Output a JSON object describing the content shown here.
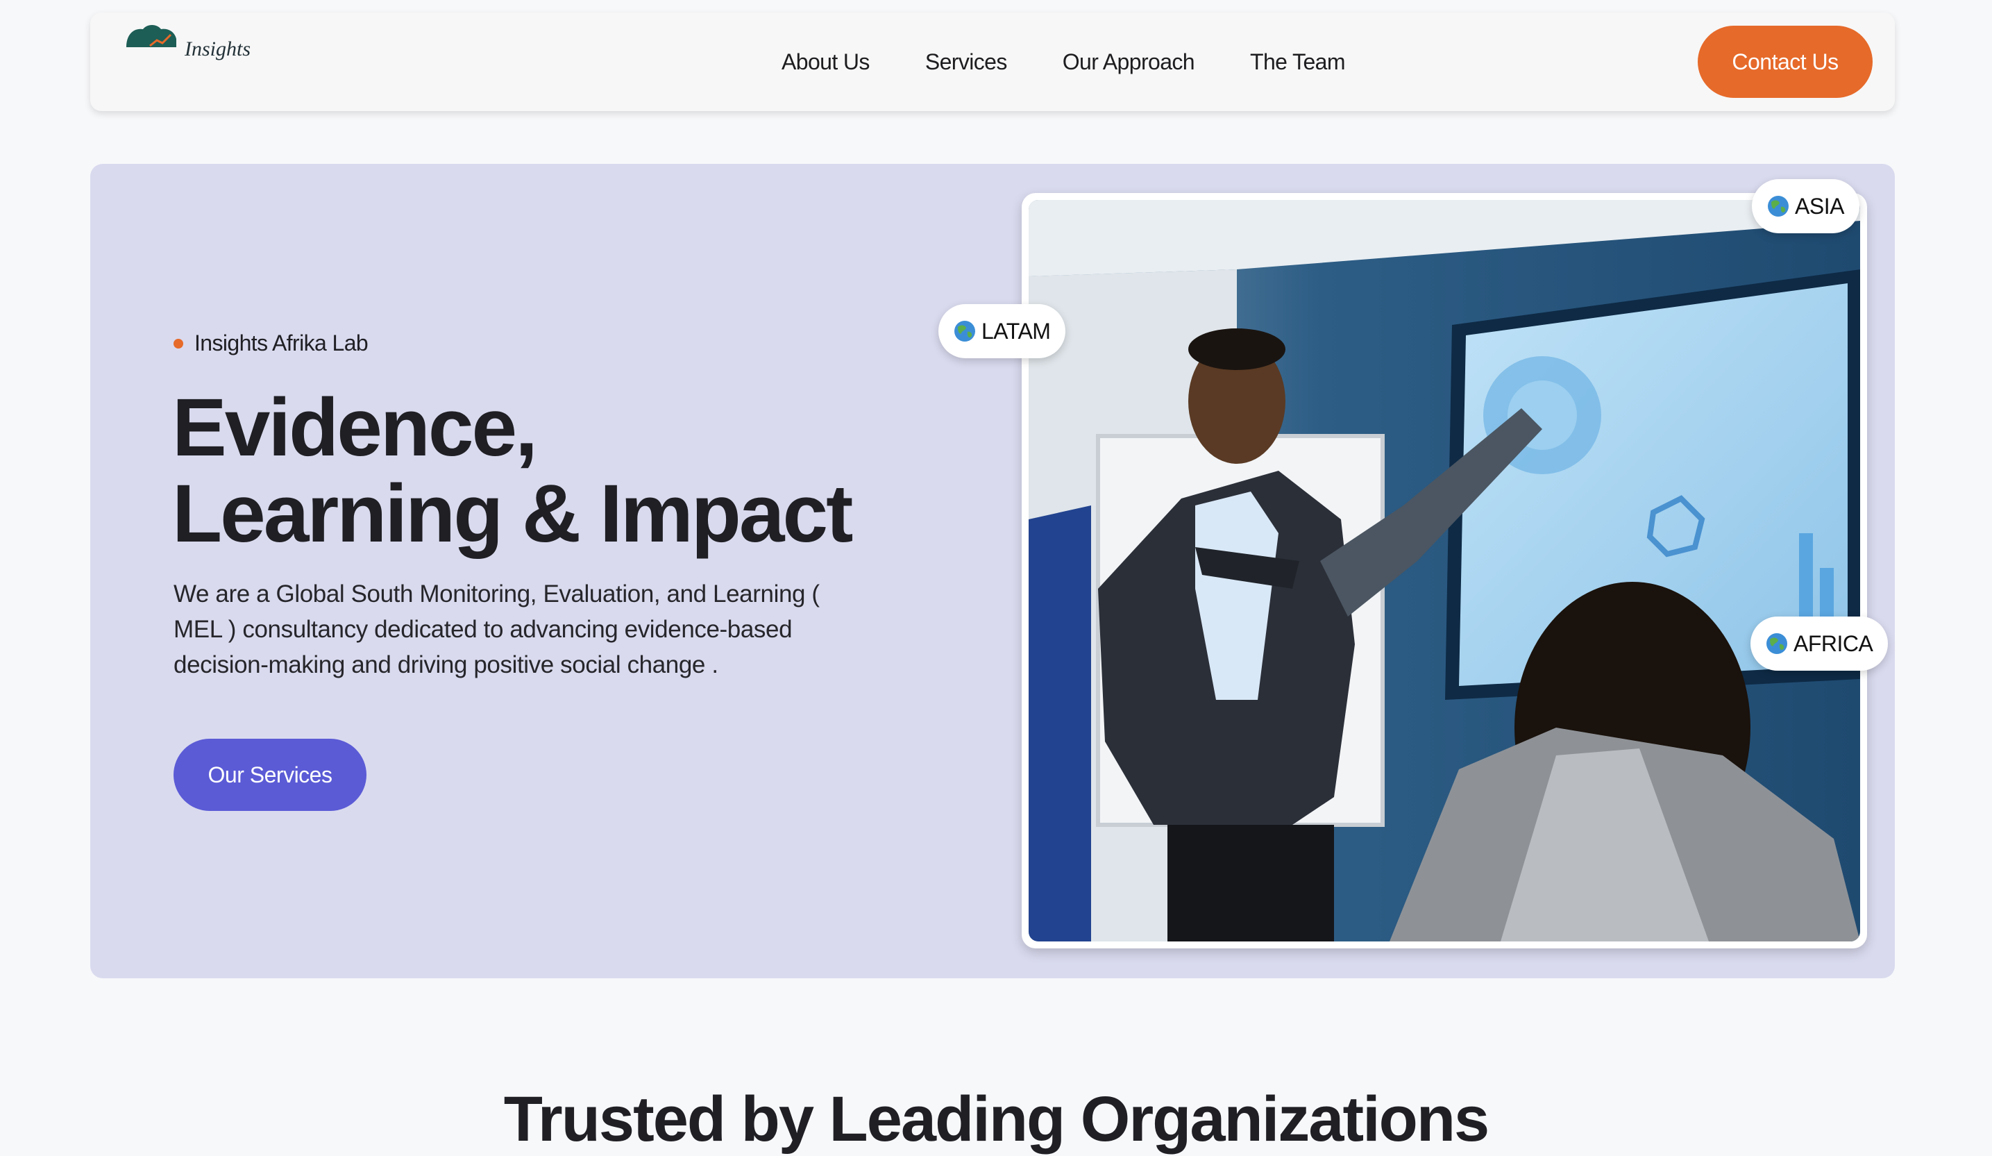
{
  "header": {
    "logo_text": "Insights",
    "nav_items": [
      {
        "label": "About Us"
      },
      {
        "label": "Services"
      },
      {
        "label": "Our Approach"
      },
      {
        "label": "The Team"
      }
    ],
    "cta_label": "Contact Us"
  },
  "hero": {
    "badge": "Insights Afrika Lab",
    "headline_line1": "Evidence,",
    "headline_line2": "Learning & Impact",
    "description": "We are a Global South Monitoring, Evaluation, and Learning ( MEL ) consultancy dedicated to advancing evidence-based decision-making and driving positive social change .",
    "button_label": "Our Services",
    "region_tags": [
      "LATAM",
      "ASIA",
      "AFRICA"
    ]
  },
  "section_next": {
    "title": "Trusted by Leading Organizations"
  },
  "colors": {
    "accent_orange": "#e66a2a",
    "accent_purple": "#5b5bd6",
    "hero_background": "#d9daee",
    "logo_green": "#1d5e56"
  },
  "icons": {
    "region_tag": "globe-icon",
    "badge_marker": "dot-icon"
  }
}
